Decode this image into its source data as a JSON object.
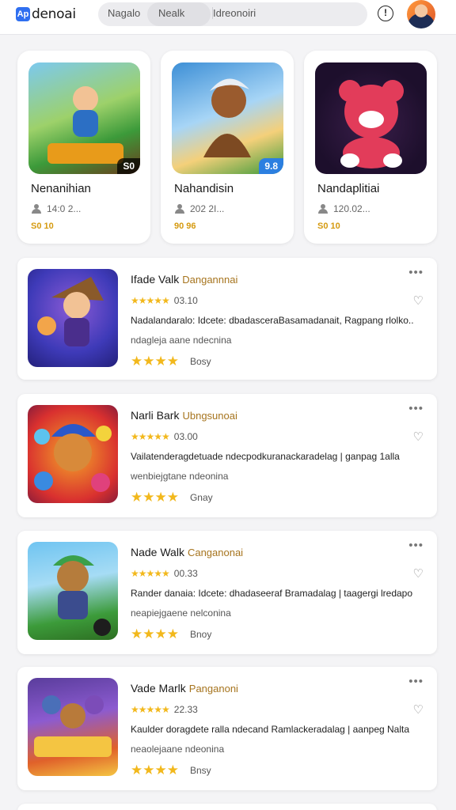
{
  "header": {
    "logo_mark": "Ap",
    "logo_text": "denoai",
    "segments": [
      "Nagalo",
      "Nealk",
      "Idreonoiri"
    ],
    "help_label": "!"
  },
  "featured": [
    {
      "title": "Nenanihian",
      "installs": "14:0 2...",
      "price": "S0 10",
      "badge": "S0",
      "art_colors": [
        "#3c9a3a",
        "#9dd16a",
        "#6b3c1c"
      ]
    },
    {
      "title": "Nahandisin",
      "installs": "202 2I...",
      "price": "90 96",
      "badge": "9.8",
      "art_colors": [
        "#3d8fd6",
        "#a7d5f6",
        "#7d4a22"
      ]
    },
    {
      "title": "Nandaplitiai",
      "installs": "120.02...",
      "price": "S0 10",
      "badge": "",
      "art_colors": [
        "#1d0f2c",
        "#e23c5a",
        "#ffffff"
      ]
    }
  ],
  "list": [
    {
      "title": "Ifade Valk",
      "developer": "Dangannnai",
      "rating_text": "03.10",
      "description": "Nadalandaralo: Idcete: dbadasceraBasamadanait, Ragpang rlolko..",
      "sub": "ndagleja aane ndecnina",
      "bottom_text": "Bosy",
      "art_colors": [
        "#3e3ab8",
        "#8b5bd6",
        "#f2a54a"
      ]
    },
    {
      "title": "Narli Bark",
      "developer": "Ubngsunoai",
      "rating_text": "03.00",
      "description": "Vailatenderagdetuade ndecpodkuranackaradelag | ganpag 1alla",
      "sub": "wenbiejgtane ndeonina",
      "bottom_text": "Gnay",
      "art_colors": [
        "#d9302f",
        "#f4a628",
        "#2b58c9"
      ]
    },
    {
      "title": "Nade Walk",
      "developer": "Canganonai",
      "rating_text": "00.33",
      "description": "Rander danaia: Idcete: dhadaseeraf Bramadalag | taagergi lredapo",
      "sub": "neapiejgaene nelconina",
      "bottom_text": "Bnoy",
      "art_colors": [
        "#6fc4f1",
        "#3c9b3a",
        "#b57c3c"
      ]
    },
    {
      "title": "Vade Marlk",
      "developer": "Panganoni",
      "rating_text": "22.33",
      "description": "Kaulder doragdete ralla ndecand Ramlackeradalag | aanpeg Nalta",
      "sub": "neaolejaane ndeonina",
      "bottom_text": "Bnsy",
      "art_colors": [
        "#5a3d9c",
        "#e0612a",
        "#f4c542"
      ]
    }
  ],
  "colors": {
    "accent": "#2f6ff0",
    "price": "#d59a10",
    "developer": "#a6741e",
    "star": "#f2b81c"
  },
  "icons": {
    "help": "help-circle-icon",
    "more": "more-horizontal-icon",
    "favorite": "heart-outline-icon",
    "installs": "person-icon"
  }
}
